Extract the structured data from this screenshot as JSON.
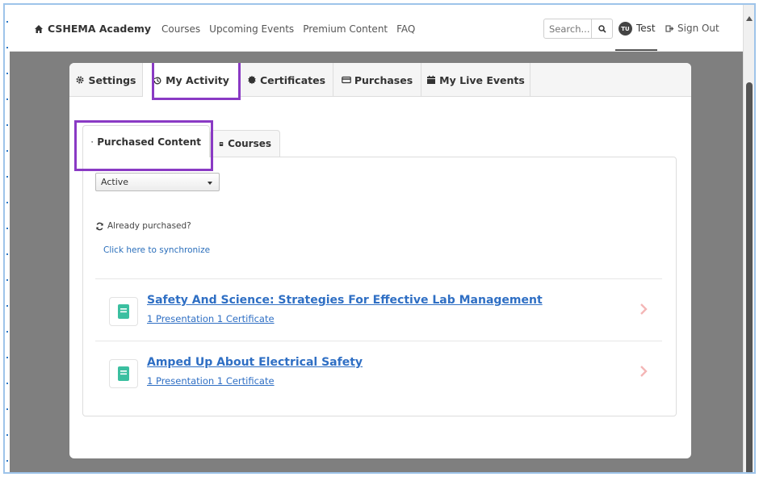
{
  "navbar": {
    "brand": "CSHEMA Academy",
    "links": [
      "Courses",
      "Upcoming Events",
      "Premium Content",
      "FAQ"
    ],
    "search_placeholder": "Search...",
    "user_initials": "TU",
    "user_name": "Test",
    "sign_out": "Sign Out"
  },
  "tabs": [
    {
      "label": "Settings",
      "icon": "gear-icon"
    },
    {
      "label": "My Activity",
      "icon": "history-icon",
      "active": true
    },
    {
      "label": "Certificates",
      "icon": "certificate-icon"
    },
    {
      "label": "Purchases",
      "icon": "credit-card-icon"
    },
    {
      "label": "My Live Events",
      "icon": "calendar-icon"
    }
  ],
  "subtabs": [
    {
      "label": "Purchased Content",
      "icon": "cart-icon",
      "active": true
    },
    {
      "label": "Courses",
      "icon": "book-icon"
    }
  ],
  "filter": {
    "selected": "Active"
  },
  "sync": {
    "question": "Already purchased?",
    "link": "Click here to synchronize"
  },
  "items": [
    {
      "title": "Safety And Science: Strategies For Effective Lab Management",
      "meta": "1 Presentation 1 Certificate"
    },
    {
      "title": "Amped Up About Electrical Safety",
      "meta": "1 Presentation 1 Certificate"
    }
  ],
  "colors": {
    "link": "#2f6fc4",
    "highlight": "#8a3ac4",
    "book_icon": "#3bbfa0"
  }
}
